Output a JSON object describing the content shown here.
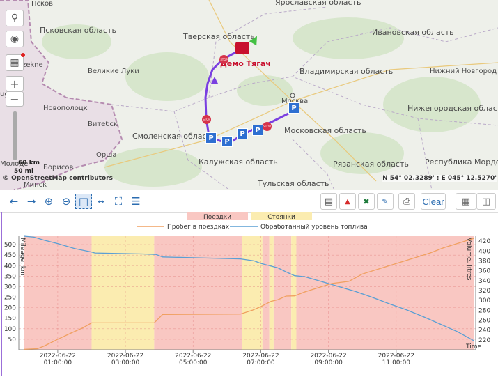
{
  "map": {
    "regions": {
      "tver": "Тверская область",
      "yaroslavl": "Ярославская область",
      "ivanovo": "Ивановская область",
      "vladimir": "Владимирская область",
      "moscow_obl": "Московская область",
      "smolensk": "Смоленская область",
      "kaluga": "Калужская область",
      "ryazan": "Рязанская область",
      "tula": "Тульская область",
      "nizhegorod": "Нижегородская область",
      "mordovia": "Республика Мордо",
      "pskov_obl": "Псковская область"
    },
    "cities": {
      "pskov": "Псков",
      "velikie_luki": "Великие Луки",
      "novopolotsk": "Новополоцк",
      "vitebsk": "Витебск",
      "orsha": "Орша",
      "borisov": "Борисов",
      "minsk": "Минск",
      "moscow": "Москва",
      "nizhny": "Нижний Новгород",
      "zekne": "zekne",
      "uga": "uga",
      "molodechno": "Молоде"
    },
    "vehicle_label": "Демо Тягач",
    "scale": {
      "km": "60 km",
      "mi": "50 mi"
    },
    "attribution": "© OpenStreetMap contributors",
    "coordinates": "N 54° 02.3289' : E 045° 12.5270'",
    "tools": {
      "zoom_in": "+",
      "zoom_out": "−"
    },
    "markers": {
      "parking": "P",
      "stop": "STOP"
    },
    "colors": {
      "route": "#7a3fe0",
      "parking": "#2e6fd1",
      "stop": "#d6334a",
      "vehicle": "#c8102e"
    }
  },
  "toolbar": {
    "clear_label": "Clear"
  },
  "chart_data": {
    "type": "line",
    "legend_bands": [
      {
        "name": "Поездки",
        "color": "#f9c7c2"
      },
      {
        "name": "Стоянки",
        "color": "#fbecb0"
      }
    ],
    "series": [
      {
        "name": "Пробег в поездках",
        "color": "#f0a060",
        "axis": "left",
        "points": [
          [
            0.0,
            2
          ],
          [
            0.4,
            5
          ],
          [
            0.6,
            18
          ],
          [
            1.0,
            50
          ],
          [
            1.4,
            80
          ],
          [
            1.75,
            105
          ],
          [
            2.0,
            128
          ],
          [
            3.5,
            128
          ],
          [
            3.85,
            128
          ],
          [
            4.1,
            168
          ],
          [
            6.4,
            170
          ],
          [
            6.75,
            188
          ],
          [
            7.0,
            205
          ],
          [
            7.3,
            230
          ],
          [
            7.5,
            238
          ],
          [
            7.75,
            255
          ],
          [
            8.0,
            256
          ],
          [
            8.3,
            275
          ],
          [
            8.8,
            300
          ],
          [
            9.1,
            315
          ],
          [
            9.6,
            325
          ],
          [
            10.0,
            360
          ],
          [
            10.6,
            390
          ],
          [
            11.0,
            410
          ],
          [
            11.5,
            435
          ],
          [
            12.0,
            460
          ],
          [
            12.4,
            485
          ],
          [
            12.8,
            505
          ],
          [
            13.3,
            530
          ]
        ]
      },
      {
        "name": "Обработанный уровень топлива",
        "color": "#5a9fd4",
        "axis": "right",
        "points": [
          [
            0.0,
            430
          ],
          [
            0.3,
            428
          ],
          [
            0.6,
            422
          ],
          [
            1.0,
            415
          ],
          [
            1.5,
            405
          ],
          [
            2.0,
            398
          ],
          [
            2.1,
            396
          ],
          [
            3.5,
            394
          ],
          [
            3.9,
            393
          ],
          [
            4.1,
            388
          ],
          [
            6.4,
            384
          ],
          [
            6.8,
            380
          ],
          [
            7.0,
            375
          ],
          [
            7.5,
            366
          ],
          [
            7.8,
            356
          ],
          [
            8.0,
            350
          ],
          [
            8.3,
            348
          ],
          [
            8.7,
            340
          ],
          [
            9.0,
            334
          ],
          [
            9.4,
            326
          ],
          [
            9.8,
            318
          ],
          [
            10.3,
            306
          ],
          [
            10.8,
            293
          ],
          [
            11.3,
            281
          ],
          [
            11.8,
            267
          ],
          [
            12.3,
            252
          ],
          [
            12.8,
            237
          ],
          [
            13.2,
            222
          ],
          [
            13.3,
            218
          ]
        ]
      }
    ],
    "bands": [
      {
        "type": "trip",
        "from": 0.0,
        "to": 2.0
      },
      {
        "type": "stop",
        "from": 2.0,
        "to": 3.85
      },
      {
        "type": "trip",
        "from": 3.85,
        "to": 6.45
      },
      {
        "type": "stop",
        "from": 6.45,
        "to": 7.05
      },
      {
        "type": "trip",
        "from": 7.05,
        "to": 7.25
      },
      {
        "type": "stop",
        "from": 7.25,
        "to": 7.38
      },
      {
        "type": "trip",
        "from": 7.38,
        "to": 7.9
      },
      {
        "type": "stop",
        "from": 7.9,
        "to": 8.05
      },
      {
        "type": "trip",
        "from": 8.05,
        "to": 13.3
      }
    ],
    "x_ticks": [
      {
        "pos": 1.0,
        "date": "2022-06-22",
        "time": "01:00:00"
      },
      {
        "pos": 3.0,
        "date": "2022-06-22",
        "time": "03:00:00"
      },
      {
        "pos": 5.0,
        "date": "2022-06-22",
        "time": "05:00:00"
      },
      {
        "pos": 7.0,
        "date": "2022-06-22",
        "time": "07:00:00"
      },
      {
        "pos": 9.0,
        "date": "2022-06-22",
        "time": "09:00:00"
      },
      {
        "pos": 11.0,
        "date": "2022-06-22",
        "time": "11:00:00"
      }
    ],
    "xlim": [
      -0.15,
      13.35
    ],
    "ylim_left": [
      0,
      540
    ],
    "ylim_right": [
      200,
      430
    ],
    "yticks_left": [
      50,
      100,
      150,
      200,
      250,
      300,
      350,
      400,
      450,
      500
    ],
    "yticks_right": [
      220,
      240,
      260,
      280,
      300,
      320,
      340,
      360,
      380,
      400,
      420
    ],
    "ylabel_left": "Mileage, km",
    "ylabel_right": "Volume, litres",
    "xlabel": "Time",
    "grid": true
  }
}
